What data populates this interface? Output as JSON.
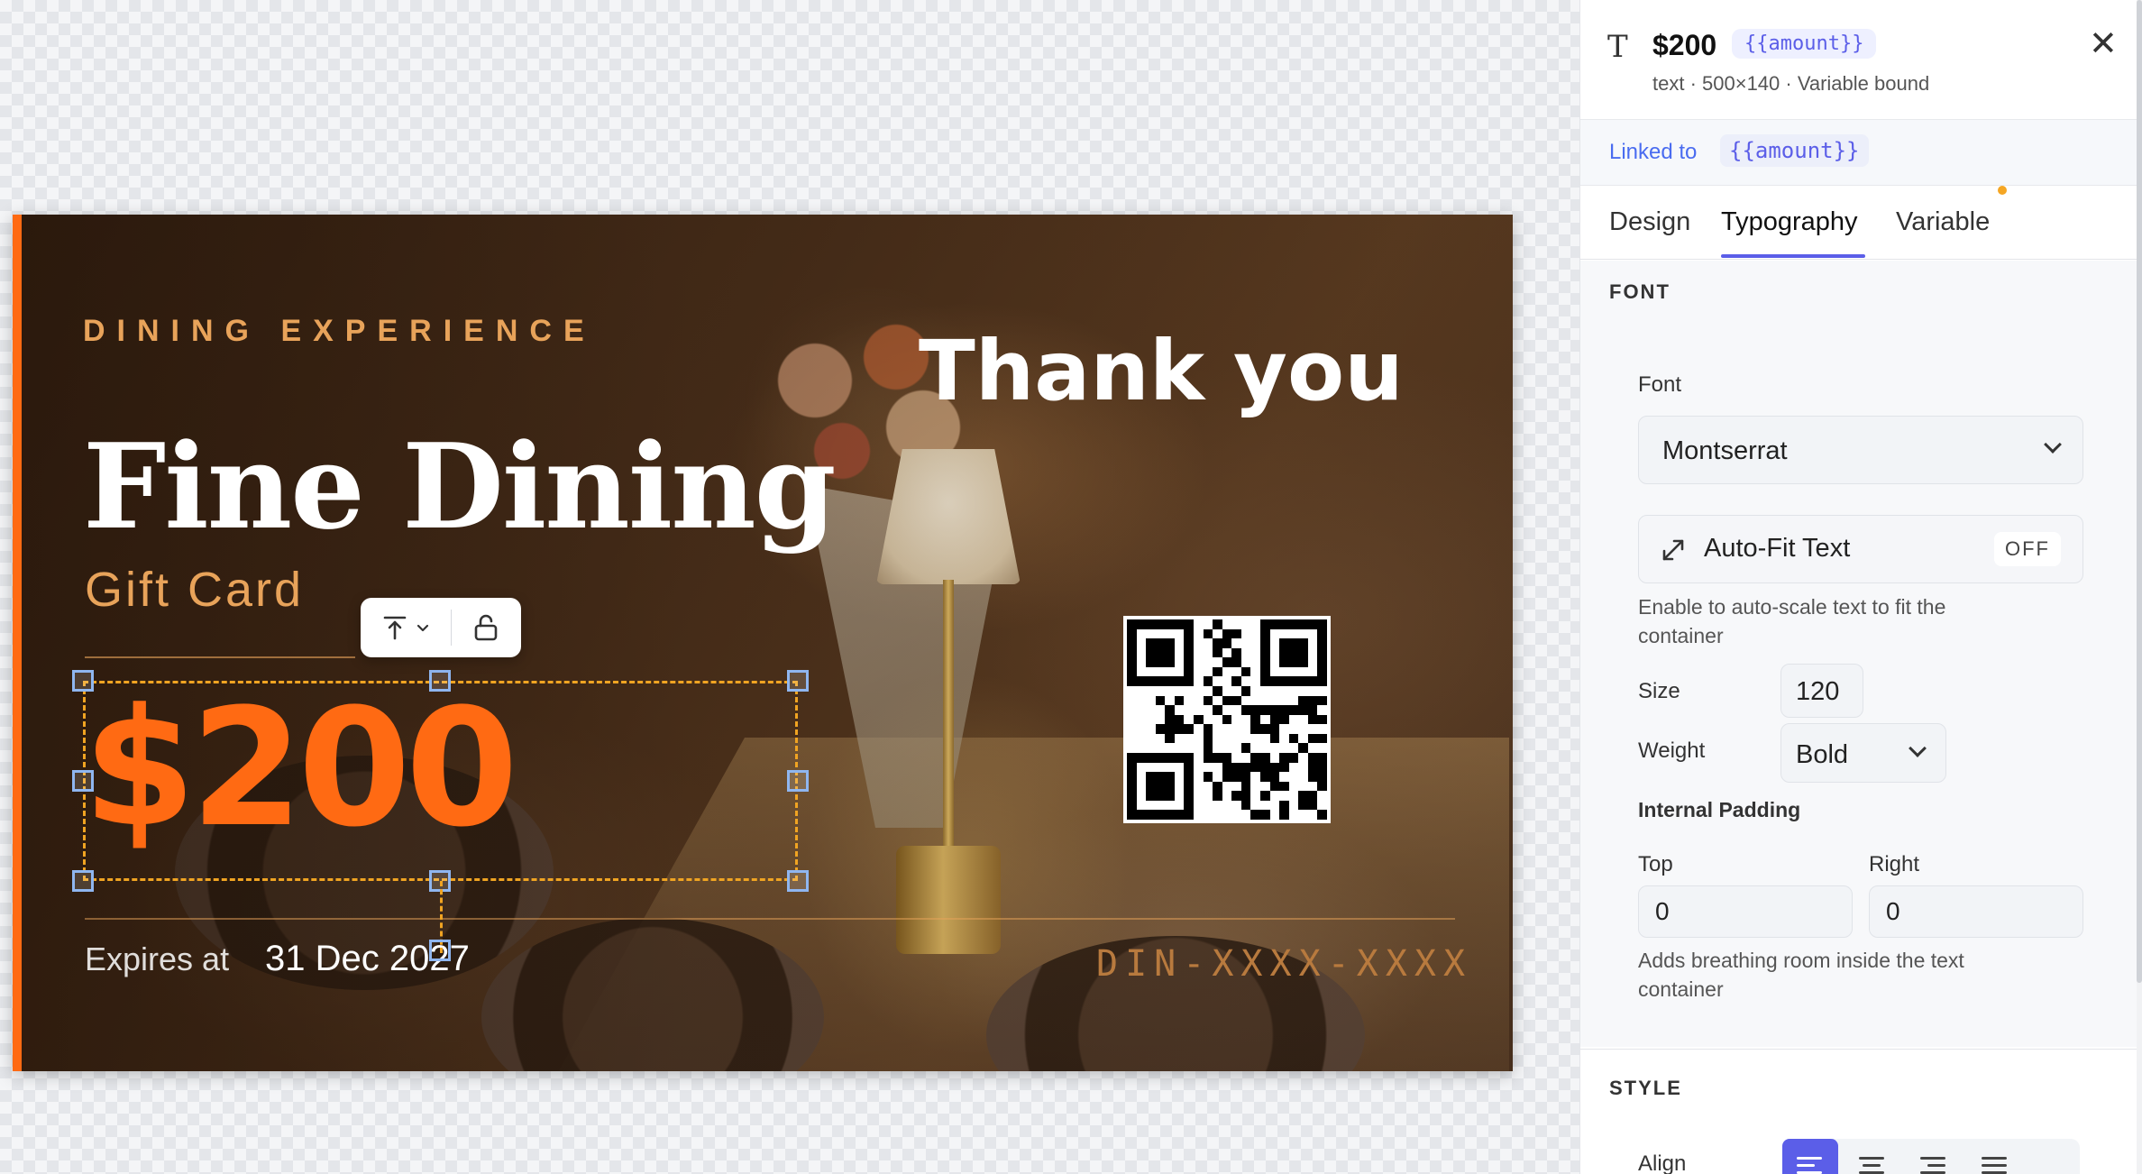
{
  "card": {
    "eyebrow": "DINING EXPERIENCE",
    "title": "Fine Dining",
    "subtitle": "Gift Card",
    "thank_you": "Thank you",
    "amount": "$200",
    "expires_label": "Expires at",
    "expires_date": "31 Dec 2027",
    "code": "DIN-XXXX-XXXX",
    "accent_color": "#ff6a13"
  },
  "float_toolbar": {
    "align_icon": "align-top-icon",
    "lock_icon": "unlock-icon"
  },
  "panel": {
    "header": {
      "type_icon": "T",
      "title": "$200",
      "variable_chip": "{{amount}}",
      "meta": "text · 500×140 · Variable bound",
      "close_icon": "✕"
    },
    "link": {
      "label": "Linked to",
      "variable": "{{amount}}"
    },
    "tabs": [
      {
        "label": "Design",
        "active": false
      },
      {
        "label": "Typography",
        "active": true
      },
      {
        "label": "Variable",
        "active": false
      }
    ],
    "font_section": {
      "heading": "FONT",
      "font_label": "Font",
      "font_value": "Montserrat",
      "autofit_icon": "expand-arrows-icon",
      "autofit_label": "Auto-Fit Text",
      "autofit_state": "OFF",
      "autofit_help": "Enable to auto-scale text to fit the container",
      "size_label": "Size",
      "size_value": "120",
      "weight_label": "Weight",
      "weight_value": "Bold",
      "padding_heading": "Internal Padding",
      "top_label": "Top",
      "top_value": "0",
      "right_label": "Right",
      "right_value": "0",
      "padding_help": "Adds breathing room inside the text container"
    },
    "style_section": {
      "heading": "STYLE",
      "align_label": "Align",
      "align_options": [
        "left",
        "center",
        "right",
        "justify"
      ],
      "align_selected": "left"
    },
    "accent_color": "#5b5ee8"
  }
}
